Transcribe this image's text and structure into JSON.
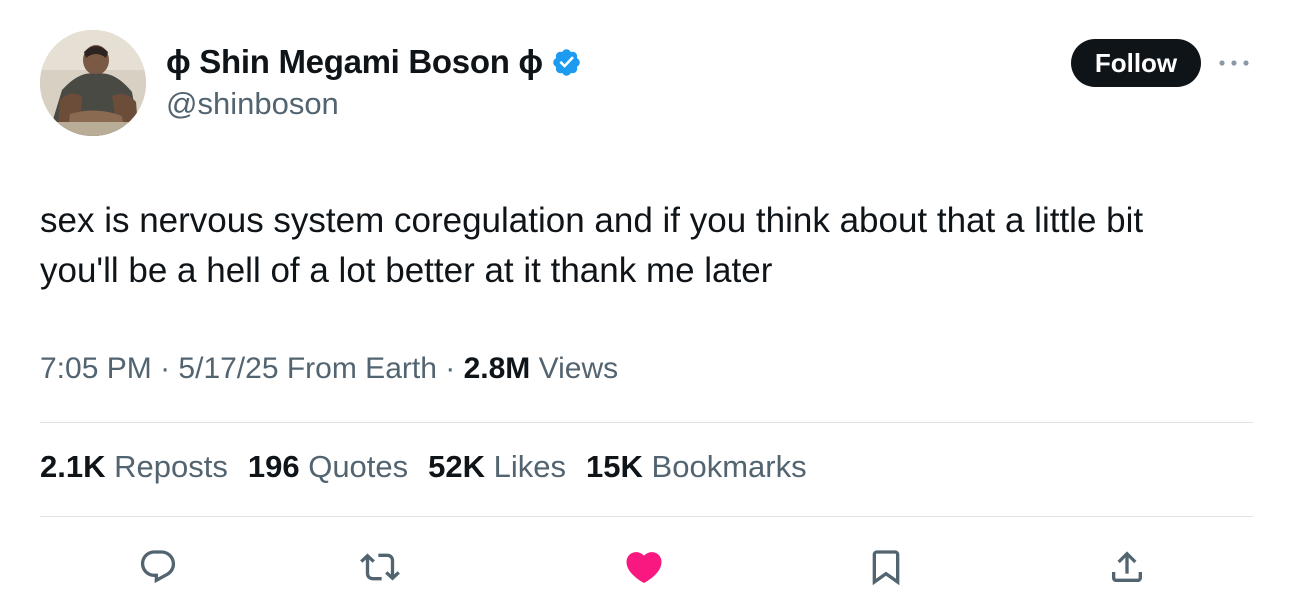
{
  "author": {
    "display_name": "ɸ Shin Megami Boson ɸ",
    "handle": "@shinboson",
    "verified": true,
    "avatar_icon": "profile-photo"
  },
  "header": {
    "follow_label": "Follow",
    "more_icon": "more-horizontal-icon"
  },
  "tweet": {
    "text": "sex is nervous system coregulation and if you think about that a little bit\nyou'll be a hell of a lot better at it thank me later"
  },
  "meta": {
    "time": "7:05 PM",
    "sep1": "·",
    "date": "5/17/25",
    "source": "From Earth",
    "sep2": "·",
    "views_count": "2.8M",
    "views_label": "Views"
  },
  "stats": {
    "reposts_count": "2.1K",
    "reposts_label": "Reposts",
    "quotes_count": "196",
    "quotes_label": "Quotes",
    "likes_count": "52K",
    "likes_label": "Likes",
    "bookmarks_count": "15K",
    "bookmarks_label": "Bookmarks"
  },
  "actions": {
    "reply_icon": "reply-icon",
    "repost_icon": "repost-icon",
    "like_icon": "heart-icon",
    "bookmark_icon": "bookmark-icon",
    "share_icon": "share-icon",
    "liked": true
  },
  "colors": {
    "text": "#0f1419",
    "secondary": "#536471",
    "verified_blue": "#1d9bf0",
    "like_pink": "#f91880",
    "follow_bg": "#0f1419"
  }
}
